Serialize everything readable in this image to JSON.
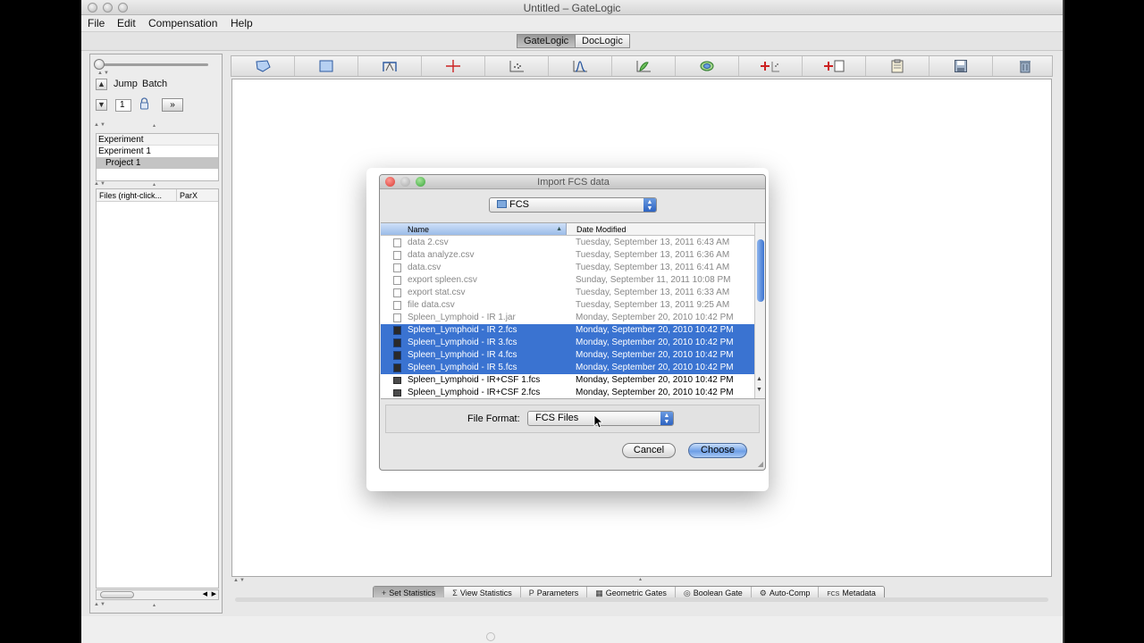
{
  "window": {
    "title": "Untitled – GateLogic"
  },
  "menu": [
    "File",
    "Edit",
    "Compensation",
    "Help"
  ],
  "modes": {
    "gatelogic": "GateLogic",
    "doclogic": "DocLogic"
  },
  "left_panel": {
    "jump_label": "Jump",
    "batch_label": "Batch",
    "jump_value": "1",
    "tree": {
      "header": "Experiment",
      "experiment": "Experiment 1",
      "project": "Project 1"
    },
    "files_header": {
      "files": "Files (right-click...",
      "parx": "ParX"
    }
  },
  "toolbar_icons": [
    "polygon-gate-icon",
    "rectangle-gate-icon",
    "range-gate-icon",
    "quadrant-gate-icon",
    "scatter-plot-icon",
    "histogram-icon",
    "contour-plot-icon",
    "overlay-plot-icon",
    "add-plot-icon",
    "add-layout-icon",
    "clipboard-icon",
    "save-icon",
    "trash-icon"
  ],
  "bottom_tabs": [
    {
      "label": "Set Statistics",
      "icon": "set-statistics-icon",
      "glyph": "+"
    },
    {
      "label": "View Statistics",
      "icon": "sigma-icon",
      "glyph": "Σ"
    },
    {
      "label": "Parameters",
      "icon": "parameters-icon",
      "glyph": "P"
    },
    {
      "label": "Geometric Gates",
      "icon": "geometric-gates-icon",
      "glyph": "▦"
    },
    {
      "label": "Boolean Gate",
      "icon": "boolean-gate-icon",
      "glyph": "◎"
    },
    {
      "label": "Auto-Comp",
      "icon": "auto-comp-icon",
      "glyph": "⚙"
    },
    {
      "label": "Metadata",
      "icon": "metadata-icon",
      "glyph": "FCS"
    }
  ],
  "dialog": {
    "title": "Import FCS data",
    "folder": "FCS",
    "columns": {
      "name": "Name",
      "date": "Date Modified"
    },
    "files": [
      {
        "name": "data 2.csv",
        "date": "Tuesday, September 13, 2011 6:43 AM",
        "state": "disabled"
      },
      {
        "name": "data analyze.csv",
        "date": "Tuesday, September 13, 2011 6:36 AM",
        "state": "disabled"
      },
      {
        "name": "data.csv",
        "date": "Tuesday, September 13, 2011 6:41 AM",
        "state": "disabled"
      },
      {
        "name": "export spleen.csv",
        "date": "Sunday, September 11, 2011 10:08 PM",
        "state": "disabled"
      },
      {
        "name": "export stat.csv",
        "date": "Tuesday, September 13, 2011 6:33 AM",
        "state": "disabled"
      },
      {
        "name": "file data.csv",
        "date": "Tuesday, September 13, 2011 9:25 AM",
        "state": "disabled"
      },
      {
        "name": "Spleen_Lymphoid - IR 1.jar",
        "date": "Monday, September 20, 2010 10:42 PM",
        "state": "disabled"
      },
      {
        "name": "Spleen_Lymphoid - IR 2.fcs",
        "date": "Monday, September 20, 2010 10:42 PM",
        "state": "selected"
      },
      {
        "name": "Spleen_Lymphoid - IR 3.fcs",
        "date": "Monday, September 20, 2010 10:42 PM",
        "state": "selected"
      },
      {
        "name": "Spleen_Lymphoid - IR 4.fcs",
        "date": "Monday, September 20, 2010 10:42 PM",
        "state": "selected"
      },
      {
        "name": "Spleen_Lymphoid - IR 5.fcs",
        "date": "Monday, September 20, 2010 10:42 PM",
        "state": "selected"
      },
      {
        "name": "Spleen_Lymphoid - IR+CSF 1.fcs",
        "date": "Monday, September 20, 2010 10:42 PM",
        "state": "enabled"
      },
      {
        "name": "Spleen_Lymphoid - IR+CSF 2.fcs",
        "date": "Monday, September 20, 2010 10:42 PM",
        "state": "enabled"
      }
    ],
    "file_format_label": "File Format:",
    "file_format_value": "FCS Files",
    "cancel_label": "Cancel",
    "choose_label": "Choose"
  },
  "colors": {
    "selection": "#3a73d1",
    "close": "#e0443e",
    "minimize": "#dfa43a",
    "zoom": "#3fb34a"
  }
}
